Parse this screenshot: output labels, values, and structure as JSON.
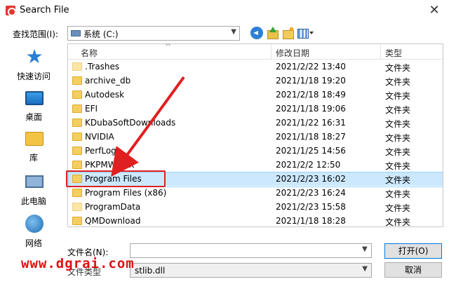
{
  "window": {
    "title": "Search File",
    "close_glyph": "✕"
  },
  "lookin": {
    "label": "查找范围(I):",
    "value": "系统 (C:)"
  },
  "places": [
    {
      "label": "快速访问",
      "icon": "quick-access-icon"
    },
    {
      "label": "桌面",
      "icon": "desktop-icon"
    },
    {
      "label": "库",
      "icon": "library-icon"
    },
    {
      "label": "此电脑",
      "icon": "this-pc-icon"
    },
    {
      "label": "网络",
      "icon": "network-icon"
    }
  ],
  "columns": {
    "name": "名称",
    "date": "修改日期",
    "type": "类型"
  },
  "files": [
    {
      "name": ".Trashes",
      "date": "2021/2/22 13:40",
      "type": "文件夹"
    },
    {
      "name": "archive_db",
      "date": "2021/1/18 19:20",
      "type": "文件夹"
    },
    {
      "name": "Autodesk",
      "date": "2021/2/18 18:49",
      "type": "文件夹"
    },
    {
      "name": "EFI",
      "date": "2021/1/18 19:06",
      "type": "文件夹"
    },
    {
      "name": "KDubaSoftDownloads",
      "date": "2021/1/22 16:31",
      "type": "文件夹"
    },
    {
      "name": "NVIDIA",
      "date": "2021/1/18 18:27",
      "type": "文件夹"
    },
    {
      "name": "PerfLogs",
      "date": "2021/1/25 14:56",
      "type": "文件夹"
    },
    {
      "name": "PKPMWORK",
      "date": "2021/2/2 12:50",
      "type": "文件夹"
    },
    {
      "name": "Program Files",
      "date": "2021/2/23 16:02",
      "type": "文件夹"
    },
    {
      "name": "Program Files (x86)",
      "date": "2021/2/23 16:24",
      "type": "文件夹"
    },
    {
      "name": "ProgramData",
      "date": "2021/2/23 15:58",
      "type": "文件夹"
    },
    {
      "name": "QMDownload",
      "date": "2021/1/18 18:28",
      "type": "文件夹"
    }
  ],
  "selected_file": "Program Files",
  "filename": {
    "label": "文件名(N):",
    "value": ""
  },
  "filetype": {
    "label": "文件类型",
    "value": "stlib.dll"
  },
  "buttons": {
    "open": "打开(O)",
    "cancel": "取消"
  },
  "watermark": "www.dgrai.com",
  "colors": {
    "selection": "#cce8ff",
    "highlight_box": "#e02020",
    "watermark": "#e01010"
  }
}
